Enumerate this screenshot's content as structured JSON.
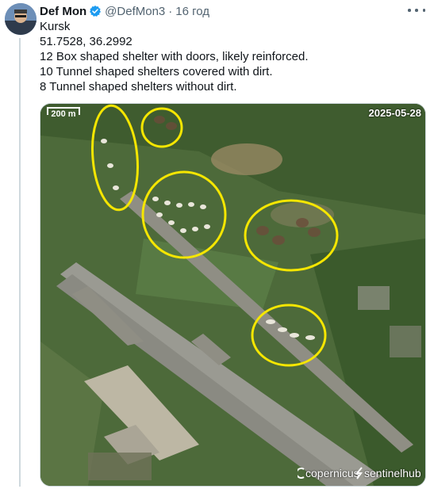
{
  "tweet": {
    "author_name": "Def Mon",
    "handle": "@DefMon3",
    "separator": "·",
    "time": "16 год",
    "lines": [
      "Kursk",
      "51.7528, 36.2992",
      "12 Box shaped shelter with doors, likely reinforced.",
      "10 Tunnel shaped shelters covered with dirt.",
      "8 Tunnel shaped shelters without dirt."
    ]
  },
  "media": {
    "scale_label": "200 m",
    "date": "2025-05-28",
    "watermark_copernicus": "copernicus",
    "watermark_sentinel": "sentinelhub",
    "highlight_color": "#f5e600"
  },
  "colors": {
    "verified_badge": "#1d9bf0",
    "secondary_text": "#536471"
  },
  "icons": [
    "verified-badge-icon",
    "more-options-icon",
    "avatar"
  ]
}
